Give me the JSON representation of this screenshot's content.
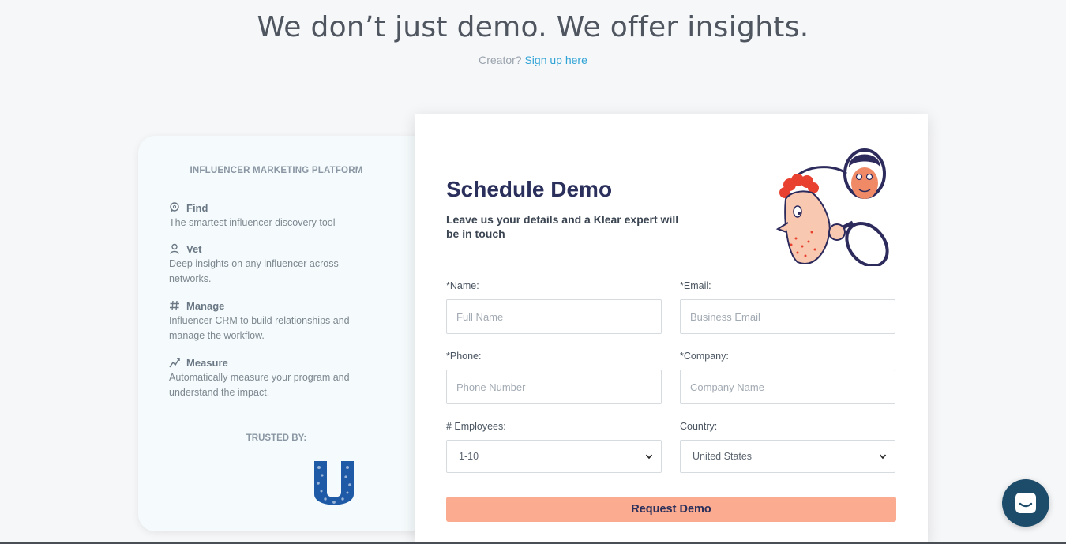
{
  "header": {
    "headline": "We don’t just demo. We offer insights.",
    "creator_prompt": "Creator?",
    "signup_link": "Sign up here"
  },
  "left_card": {
    "title": "INFLUENCER MARKETING PLATFORM",
    "features": [
      {
        "icon": "search-chat-icon",
        "name": "Find",
        "desc": "The smartest influencer discovery tool"
      },
      {
        "icon": "person-icon",
        "name": "Vet",
        "desc": "Deep insights on any influencer across networks."
      },
      {
        "icon": "hashtag-icon",
        "name": "Manage",
        "desc": "Influencer CRM to build relationships and manage the workflow."
      },
      {
        "icon": "trend-icon",
        "name": "Measure",
        "desc": "Automatically measure your program and understand the impact."
      }
    ],
    "trusted_label": "TRUSTED BY:",
    "logo_text": "Unilever"
  },
  "form": {
    "title": "Schedule Demo",
    "subtitle": "Leave us your details and a Klear expert will be in touch",
    "fields": {
      "name": {
        "label": "*Name:",
        "placeholder": "Full Name"
      },
      "email": {
        "label": "*Email:",
        "placeholder": "Business Email"
      },
      "phone": {
        "label": "*Phone:",
        "placeholder": "Phone Number"
      },
      "company": {
        "label": "*Company:",
        "placeholder": "Company Name"
      },
      "employees": {
        "label": "# Employees:",
        "value": "1-10"
      },
      "country": {
        "label": "Country:",
        "value": "United States"
      }
    },
    "submit_label": "Request Demo"
  },
  "colors": {
    "accent_link": "#2fa3d6",
    "title_navy": "#2a2f5b",
    "button_peach": "#fbab8f",
    "chat_bubble": "#1d4c6a"
  }
}
